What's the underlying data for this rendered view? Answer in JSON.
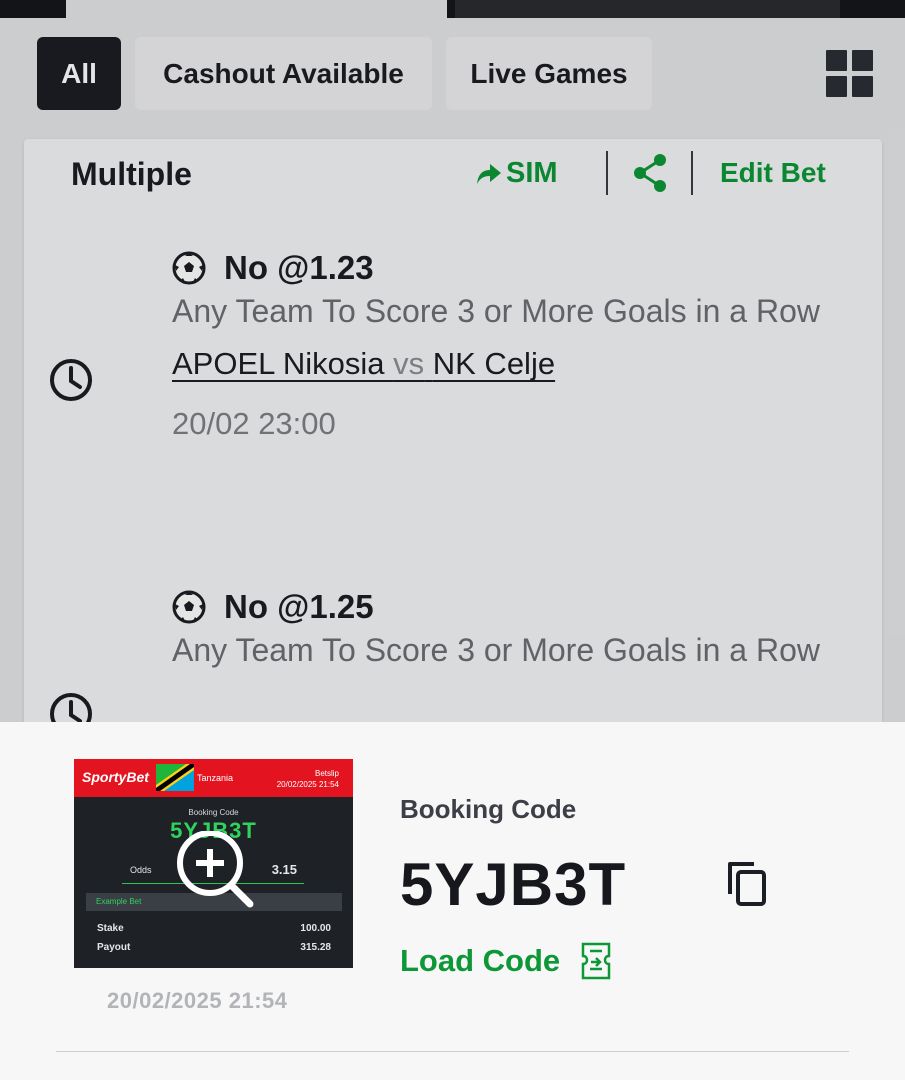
{
  "filters": {
    "all": "All",
    "cashout": "Cashout Available",
    "live": "Live Games"
  },
  "bet": {
    "type": "Multiple",
    "sim_label": "SIM",
    "edit_label": "Edit Bet",
    "selections": [
      {
        "pick": "No @1.23",
        "market": "Any Team To Score 3 or More Goals in a Row",
        "home": "APOEL Nikosia",
        "vs": "vs",
        "away": "NK Celje",
        "time": "20/02 23:00"
      },
      {
        "pick": "No @1.25",
        "market": "Any Team To Score 3 or More Goals in a Row"
      }
    ]
  },
  "booking": {
    "label": "Booking Code",
    "code": "5YJB3T",
    "load_label": "Load Code",
    "date": "20/02/2025 21:54"
  },
  "thumbnail": {
    "brand": "SportyBet",
    "country": "Tanzania",
    "betslip_label": "Betslip",
    "betslip_date": "20/02/2025 21:54",
    "booking_label": "Booking Code",
    "code": "5YJB3T",
    "odds_label": "Odds",
    "odds_value": "3.15",
    "example_label": "Example Bet",
    "stake_label": "Stake",
    "stake_value": "100.00",
    "payout_label": "Payout",
    "payout_value": "315.28"
  },
  "icons": {
    "grid": "grid-view-icon",
    "sim": "share-arrow-icon",
    "share": "share-icon",
    "sport": "soccer-ball-icon",
    "clock": "clock-icon",
    "zoom": "zoom-in-icon",
    "copy": "copy-icon",
    "load": "ticket-load-icon"
  },
  "colors": {
    "accent_green": "#0d9737",
    "brand_red": "#e3141f",
    "dark": "#1b1e24",
    "code_green": "#2fd35b"
  }
}
